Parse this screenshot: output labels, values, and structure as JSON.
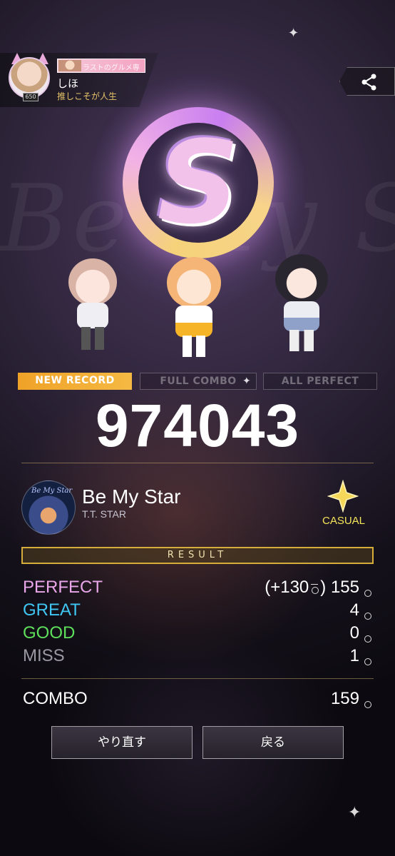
{
  "background_title": "Be My Star",
  "profile": {
    "level": "650",
    "title_plate": "ラストのグルメ専",
    "name": "しほ",
    "subtitle": "推しこそが人生"
  },
  "result": {
    "rank": "S",
    "badges": {
      "new_record": "NEW RECORD",
      "full_combo": "FULL COMBO",
      "all_perfect": "ALL PERFECT"
    },
    "score": "974043",
    "song": {
      "title": "Be My Star",
      "artist": "T.T. STAR",
      "jacket_text": "Be My Star",
      "difficulty": "CASUAL"
    },
    "section_label": "RESULT",
    "stats": {
      "perfect": {
        "label": "PERFECT",
        "bonus": "(+130",
        "bonus_close": ")",
        "value": "155"
      },
      "great": {
        "label": "GREAT",
        "value": "4"
      },
      "good": {
        "label": "GOOD",
        "value": "0"
      },
      "miss": {
        "label": "MISS",
        "value": "1"
      },
      "combo": {
        "label": "COMBO",
        "value": "159"
      }
    },
    "unit_symbol": "回"
  },
  "buttons": {
    "retry": "やり直す",
    "back": "戻る"
  },
  "colors": {
    "perfect": "#e9a6ea",
    "great": "#3fc6f2",
    "good": "#5ee05c",
    "miss": "#9a98a3",
    "badge_new": "#f0a228",
    "difficulty": "#f4e45a",
    "result_bar_border": "#d6ad3b"
  },
  "icons": {
    "share": "share-icon",
    "difficulty": "star-icon"
  }
}
